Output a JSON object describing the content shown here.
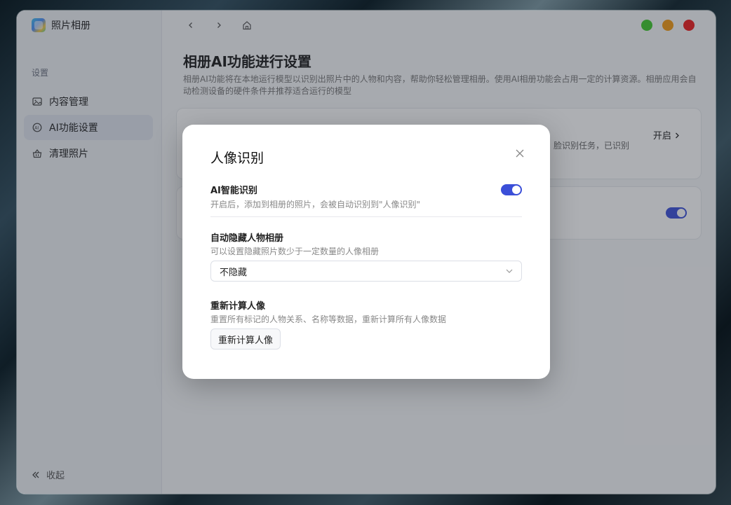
{
  "app": {
    "name": "照片相册",
    "logo_icon": "photo-album-app-icon"
  },
  "sidebar": {
    "section_label": "设置",
    "items": [
      {
        "label": "内容管理",
        "icon": "image-icon"
      },
      {
        "label": "AI功能设置",
        "icon": "ai-icon",
        "active": true
      },
      {
        "label": "清理照片",
        "icon": "basket-icon"
      }
    ],
    "collapse_label": "收起"
  },
  "window_controls": {
    "colors": [
      "#3ec92b",
      "#f39a12",
      "#ee1c1c"
    ]
  },
  "page": {
    "title": "相册AI功能进行设置",
    "description": "相册AI功能将在本地运行模型以识别出照片中的人物和内容，帮助你轻松管理相册。使用AI相册功能会占用一定的计算资源。相册应用会自动检测设备的硬件条件并推荐适合运行的模型",
    "card1": {
      "action_label": "开启",
      "peek_text": "脸识别任务，已识别"
    }
  },
  "modal": {
    "title": "人像识别",
    "ai_recognition": {
      "title": "AI智能识别",
      "description": "开启后，添加到相册的照片，会被自动识别到\"人像识别\"",
      "enabled": true
    },
    "auto_hide": {
      "title": "自动隐藏人物相册",
      "description": "可以设置隐藏照片数少于一定数量的人像相册",
      "selected": "不隐藏"
    },
    "recalc": {
      "title": "重新计算人像",
      "description": "重置所有标记的人物关系、名称等数据，重新计算所有人像数据",
      "button_label": "重新计算人像"
    }
  },
  "colors": {
    "accent": "#3b4fd8"
  }
}
